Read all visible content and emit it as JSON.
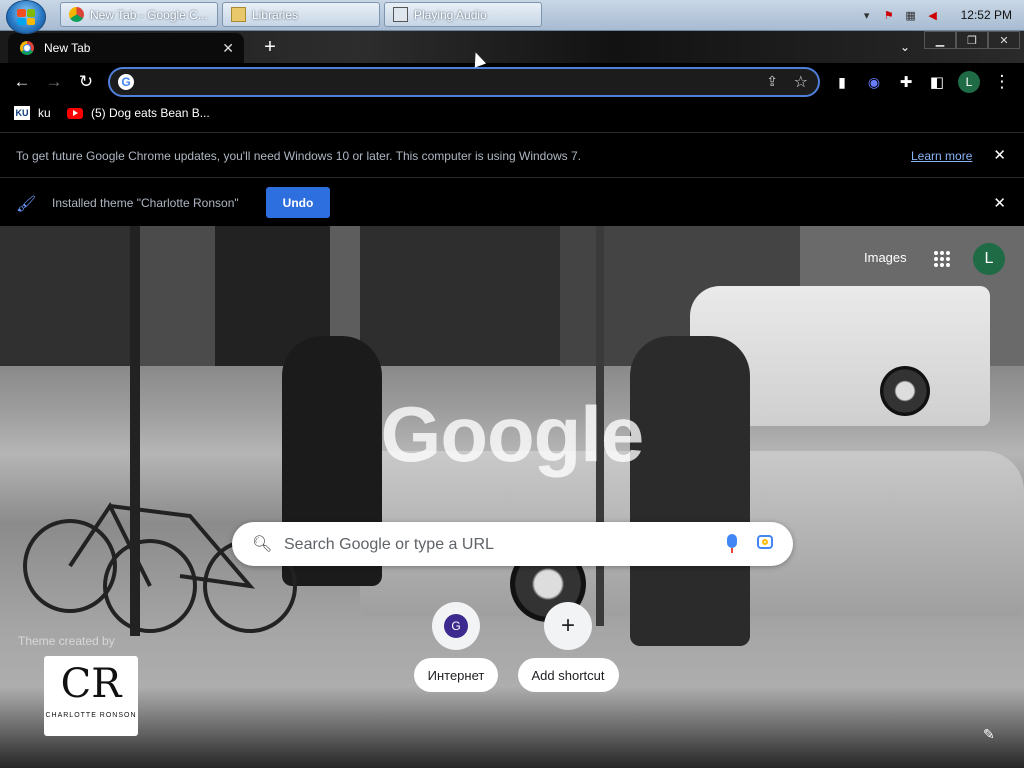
{
  "taskbar": {
    "buttons": [
      {
        "label": "New Tab - Google C..."
      },
      {
        "label": "Libraries"
      },
      {
        "label": "Playing Audio"
      }
    ],
    "clock": "12:52 PM"
  },
  "tab": {
    "title": "New Tab"
  },
  "omnibox": {
    "value": ""
  },
  "bookmarks": [
    {
      "label": "ku"
    },
    {
      "label": "(5) Dog eats Bean B..."
    }
  ],
  "infobar_update": {
    "message": "To get future Google Chrome updates, you'll need Windows 10 or later. This computer is using Windows 7.",
    "link": "Learn more"
  },
  "infobar_theme": {
    "message": "Installed theme \"Charlotte Ronson\"",
    "undo_label": "Undo"
  },
  "ntp": {
    "images_link": "Images",
    "avatar_letter": "L",
    "logo_text": "Google",
    "search_placeholder": "Search Google or type a URL",
    "shortcuts": [
      {
        "icon_letter": "G",
        "label": "Интернет"
      },
      {
        "icon_symbol": "+",
        "label": "Add shortcut"
      }
    ],
    "theme_credit": "Theme created by",
    "theme_brand": "CHARLOTTE RONSON",
    "theme_monogram": "CR"
  },
  "colors": {
    "accent": "#4f7fd9",
    "undo_button": "#2e6fe0",
    "link": "#8ab4f8",
    "avatar": "#1e6b46"
  }
}
